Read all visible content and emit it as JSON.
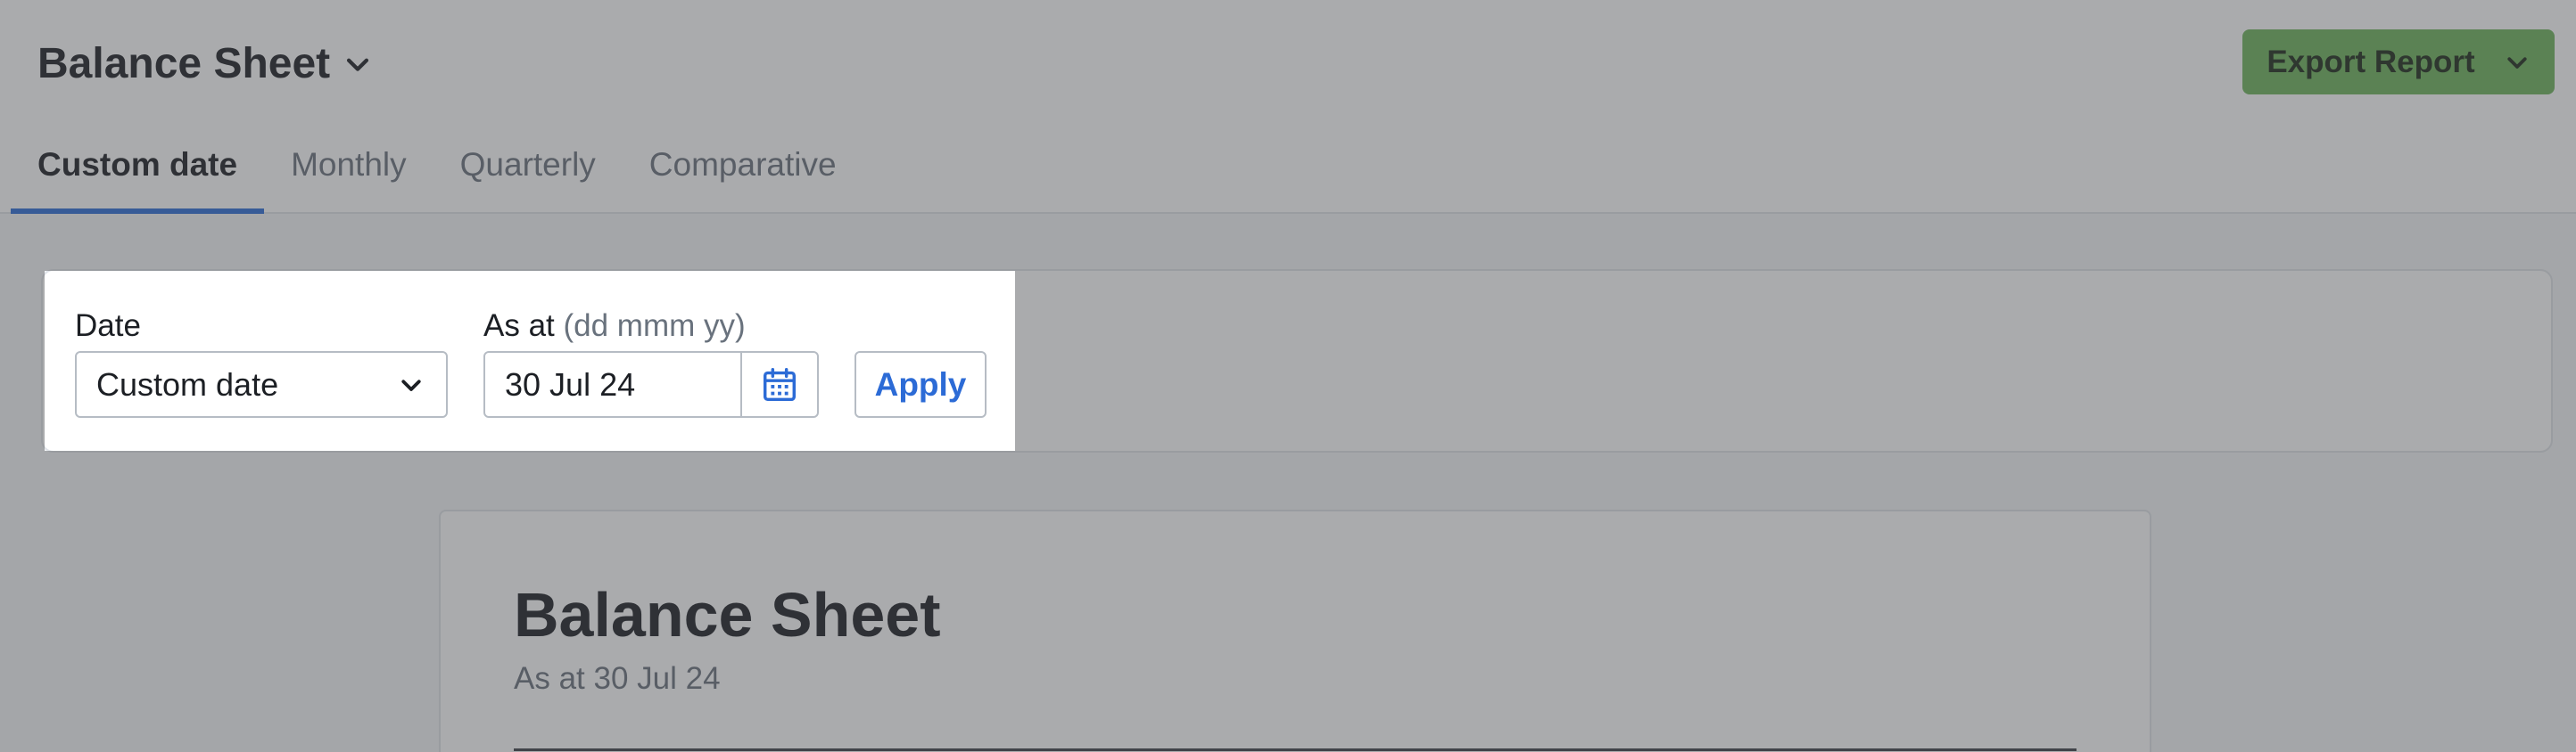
{
  "header": {
    "report_title": "Balance Sheet",
    "export_label": "Export Report"
  },
  "tabs": [
    {
      "label": "Custom date",
      "active": true
    },
    {
      "label": "Monthly",
      "active": false
    },
    {
      "label": "Quarterly",
      "active": false
    },
    {
      "label": "Comparative",
      "active": false
    }
  ],
  "filters": {
    "date_label": "Date",
    "date_value": "Custom date",
    "as_at_label": "As at",
    "as_at_hint": "(dd mmm yy)",
    "as_at_value": "30 Jul 24",
    "apply_label": "Apply"
  },
  "report": {
    "title": "Balance Sheet",
    "subtitle": "As at 30 Jul 24"
  },
  "icons": {
    "title_dropdown": "chevron-down-icon",
    "export_dropdown": "chevron-down-icon",
    "calendar": "calendar-icon"
  },
  "colors": {
    "accent_blue": "#2c6bd6",
    "export_green": "#6db35c",
    "overlay": "#46484c"
  }
}
